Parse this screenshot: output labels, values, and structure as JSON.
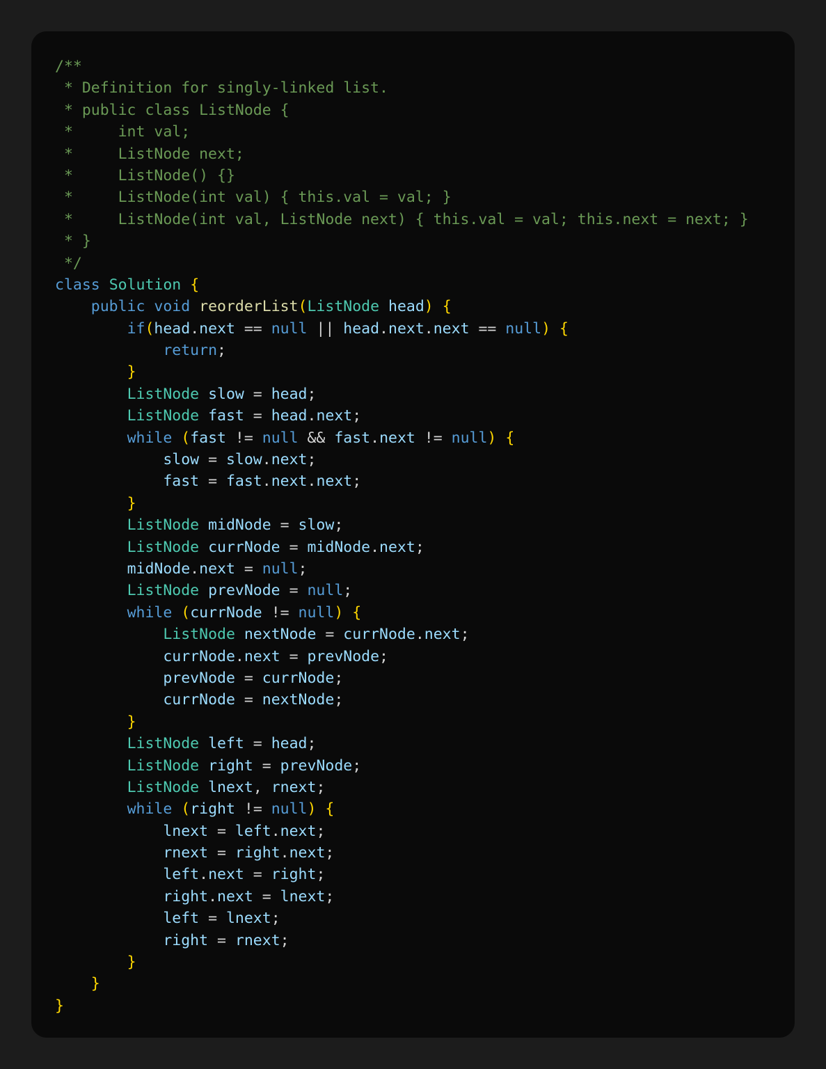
{
  "colors": {
    "page_background": "#1c1c1c",
    "editor_background": "#0a0a0a",
    "comment": "#6a9955",
    "keyword": "#569cd6",
    "type": "#4ec9b0",
    "class_name": "#4ec9b0",
    "method": "#dcdcaa",
    "identifier": "#9cdcfe",
    "punctuation": "#d4d4d4",
    "brace": "#ffd700"
  },
  "code": {
    "language": "java",
    "lines": [
      [
        [
          "comment",
          "/**"
        ]
      ],
      [
        [
          "comment",
          " * Definition for singly-linked list."
        ]
      ],
      [
        [
          "comment",
          " * public class ListNode {"
        ]
      ],
      [
        [
          "comment",
          " *     int val;"
        ]
      ],
      [
        [
          "comment",
          " *     ListNode next;"
        ]
      ],
      [
        [
          "comment",
          " *     ListNode() {}"
        ]
      ],
      [
        [
          "comment",
          " *     ListNode(int val) { this.val = val; }"
        ]
      ],
      [
        [
          "comment",
          " *     ListNode(int val, ListNode next) { this.val = val; this.next = next; }"
        ]
      ],
      [
        [
          "comment",
          " * }"
        ]
      ],
      [
        [
          "comment",
          " */"
        ]
      ],
      [
        [
          "keyword",
          "class"
        ],
        [
          "ws",
          " "
        ],
        [
          "class",
          "Solution"
        ],
        [
          "ws",
          " "
        ],
        [
          "brace",
          "{"
        ]
      ],
      [
        [
          "ws",
          "    "
        ],
        [
          "keyword",
          "public"
        ],
        [
          "ws",
          " "
        ],
        [
          "keyword",
          "void"
        ],
        [
          "ws",
          " "
        ],
        [
          "method",
          "reorderList"
        ],
        [
          "brace",
          "("
        ],
        [
          "type",
          "ListNode"
        ],
        [
          "ws",
          " "
        ],
        [
          "ident",
          "head"
        ],
        [
          "brace",
          ")"
        ],
        [
          "ws",
          " "
        ],
        [
          "brace",
          "{"
        ]
      ],
      [
        [
          "ws",
          "        "
        ],
        [
          "keyword",
          "if"
        ],
        [
          "brace",
          "("
        ],
        [
          "ident",
          "head"
        ],
        [
          "punct",
          "."
        ],
        [
          "ident",
          "next"
        ],
        [
          "punct",
          " == "
        ],
        [
          "keyword",
          "null"
        ],
        [
          "punct",
          " || "
        ],
        [
          "ident",
          "head"
        ],
        [
          "punct",
          "."
        ],
        [
          "ident",
          "next"
        ],
        [
          "punct",
          "."
        ],
        [
          "ident",
          "next"
        ],
        [
          "punct",
          " == "
        ],
        [
          "keyword",
          "null"
        ],
        [
          "brace",
          ")"
        ],
        [
          "ws",
          " "
        ],
        [
          "brace",
          "{"
        ]
      ],
      [
        [
          "ws",
          "            "
        ],
        [
          "keyword",
          "return"
        ],
        [
          "punct",
          ";"
        ]
      ],
      [
        [
          "ws",
          "        "
        ],
        [
          "brace",
          "}"
        ]
      ],
      [
        [
          "ws",
          "        "
        ],
        [
          "type",
          "ListNode"
        ],
        [
          "ws",
          " "
        ],
        [
          "ident",
          "slow"
        ],
        [
          "punct",
          " = "
        ],
        [
          "ident",
          "head"
        ],
        [
          "punct",
          ";"
        ]
      ],
      [
        [
          "ws",
          "        "
        ],
        [
          "type",
          "ListNode"
        ],
        [
          "ws",
          " "
        ],
        [
          "ident",
          "fast"
        ],
        [
          "punct",
          " = "
        ],
        [
          "ident",
          "head"
        ],
        [
          "punct",
          "."
        ],
        [
          "ident",
          "next"
        ],
        [
          "punct",
          ";"
        ]
      ],
      [
        [
          "ws",
          "        "
        ],
        [
          "keyword",
          "while"
        ],
        [
          "ws",
          " "
        ],
        [
          "brace",
          "("
        ],
        [
          "ident",
          "fast"
        ],
        [
          "punct",
          " != "
        ],
        [
          "keyword",
          "null"
        ],
        [
          "punct",
          " && "
        ],
        [
          "ident",
          "fast"
        ],
        [
          "punct",
          "."
        ],
        [
          "ident",
          "next"
        ],
        [
          "punct",
          " != "
        ],
        [
          "keyword",
          "null"
        ],
        [
          "brace",
          ")"
        ],
        [
          "ws",
          " "
        ],
        [
          "brace",
          "{"
        ]
      ],
      [
        [
          "ws",
          "            "
        ],
        [
          "ident",
          "slow"
        ],
        [
          "punct",
          " = "
        ],
        [
          "ident",
          "slow"
        ],
        [
          "punct",
          "."
        ],
        [
          "ident",
          "next"
        ],
        [
          "punct",
          ";"
        ]
      ],
      [
        [
          "ws",
          "            "
        ],
        [
          "ident",
          "fast"
        ],
        [
          "punct",
          " = "
        ],
        [
          "ident",
          "fast"
        ],
        [
          "punct",
          "."
        ],
        [
          "ident",
          "next"
        ],
        [
          "punct",
          "."
        ],
        [
          "ident",
          "next"
        ],
        [
          "punct",
          ";"
        ]
      ],
      [
        [
          "ws",
          "        "
        ],
        [
          "brace",
          "}"
        ]
      ],
      [
        [
          "ws",
          "        "
        ],
        [
          "type",
          "ListNode"
        ],
        [
          "ws",
          " "
        ],
        [
          "ident",
          "midNode"
        ],
        [
          "punct",
          " = "
        ],
        [
          "ident",
          "slow"
        ],
        [
          "punct",
          ";"
        ]
      ],
      [
        [
          "ws",
          "        "
        ],
        [
          "type",
          "ListNode"
        ],
        [
          "ws",
          " "
        ],
        [
          "ident",
          "currNode"
        ],
        [
          "punct",
          " = "
        ],
        [
          "ident",
          "midNode"
        ],
        [
          "punct",
          "."
        ],
        [
          "ident",
          "next"
        ],
        [
          "punct",
          ";"
        ]
      ],
      [
        [
          "ws",
          "        "
        ],
        [
          "ident",
          "midNode"
        ],
        [
          "punct",
          "."
        ],
        [
          "ident",
          "next"
        ],
        [
          "punct",
          " = "
        ],
        [
          "keyword",
          "null"
        ],
        [
          "punct",
          ";"
        ]
      ],
      [
        [
          "ws",
          "        "
        ],
        [
          "type",
          "ListNode"
        ],
        [
          "ws",
          " "
        ],
        [
          "ident",
          "prevNode"
        ],
        [
          "punct",
          " = "
        ],
        [
          "keyword",
          "null"
        ],
        [
          "punct",
          ";"
        ]
      ],
      [
        [
          "ws",
          "        "
        ],
        [
          "keyword",
          "while"
        ],
        [
          "ws",
          " "
        ],
        [
          "brace",
          "("
        ],
        [
          "ident",
          "currNode"
        ],
        [
          "punct",
          " != "
        ],
        [
          "keyword",
          "null"
        ],
        [
          "brace",
          ")"
        ],
        [
          "ws",
          " "
        ],
        [
          "brace",
          "{"
        ]
      ],
      [
        [
          "ws",
          "            "
        ],
        [
          "type",
          "ListNode"
        ],
        [
          "ws",
          " "
        ],
        [
          "ident",
          "nextNode"
        ],
        [
          "punct",
          " = "
        ],
        [
          "ident",
          "currNode"
        ],
        [
          "punct",
          "."
        ],
        [
          "ident",
          "next"
        ],
        [
          "punct",
          ";"
        ]
      ],
      [
        [
          "ws",
          "            "
        ],
        [
          "ident",
          "currNode"
        ],
        [
          "punct",
          "."
        ],
        [
          "ident",
          "next"
        ],
        [
          "punct",
          " = "
        ],
        [
          "ident",
          "prevNode"
        ],
        [
          "punct",
          ";"
        ]
      ],
      [
        [
          "ws",
          "            "
        ],
        [
          "ident",
          "prevNode"
        ],
        [
          "punct",
          " = "
        ],
        [
          "ident",
          "currNode"
        ],
        [
          "punct",
          ";"
        ]
      ],
      [
        [
          "ws",
          "            "
        ],
        [
          "ident",
          "currNode"
        ],
        [
          "punct",
          " = "
        ],
        [
          "ident",
          "nextNode"
        ],
        [
          "punct",
          ";"
        ]
      ],
      [
        [
          "ws",
          "        "
        ],
        [
          "brace",
          "}"
        ]
      ],
      [
        [
          "ws",
          "        "
        ],
        [
          "type",
          "ListNode"
        ],
        [
          "ws",
          " "
        ],
        [
          "ident",
          "left"
        ],
        [
          "punct",
          " = "
        ],
        [
          "ident",
          "head"
        ],
        [
          "punct",
          ";"
        ]
      ],
      [
        [
          "ws",
          "        "
        ],
        [
          "type",
          "ListNode"
        ],
        [
          "ws",
          " "
        ],
        [
          "ident",
          "right"
        ],
        [
          "punct",
          " = "
        ],
        [
          "ident",
          "prevNode"
        ],
        [
          "punct",
          ";"
        ]
      ],
      [
        [
          "ws",
          "        "
        ],
        [
          "type",
          "ListNode"
        ],
        [
          "ws",
          " "
        ],
        [
          "ident",
          "lnext"
        ],
        [
          "punct",
          ", "
        ],
        [
          "ident",
          "rnext"
        ],
        [
          "punct",
          ";"
        ]
      ],
      [
        [
          "ws",
          "        "
        ],
        [
          "keyword",
          "while"
        ],
        [
          "ws",
          " "
        ],
        [
          "brace",
          "("
        ],
        [
          "ident",
          "right"
        ],
        [
          "punct",
          " != "
        ],
        [
          "keyword",
          "null"
        ],
        [
          "brace",
          ")"
        ],
        [
          "ws",
          " "
        ],
        [
          "brace",
          "{"
        ]
      ],
      [
        [
          "ws",
          "            "
        ],
        [
          "ident",
          "lnext"
        ],
        [
          "punct",
          " = "
        ],
        [
          "ident",
          "left"
        ],
        [
          "punct",
          "."
        ],
        [
          "ident",
          "next"
        ],
        [
          "punct",
          ";"
        ]
      ],
      [
        [
          "ws",
          "            "
        ],
        [
          "ident",
          "rnext"
        ],
        [
          "punct",
          " = "
        ],
        [
          "ident",
          "right"
        ],
        [
          "punct",
          "."
        ],
        [
          "ident",
          "next"
        ],
        [
          "punct",
          ";"
        ]
      ],
      [
        [
          "ws",
          "            "
        ],
        [
          "ident",
          "left"
        ],
        [
          "punct",
          "."
        ],
        [
          "ident",
          "next"
        ],
        [
          "punct",
          " = "
        ],
        [
          "ident",
          "right"
        ],
        [
          "punct",
          ";"
        ]
      ],
      [
        [
          "ws",
          "            "
        ],
        [
          "ident",
          "right"
        ],
        [
          "punct",
          "."
        ],
        [
          "ident",
          "next"
        ],
        [
          "punct",
          " = "
        ],
        [
          "ident",
          "lnext"
        ],
        [
          "punct",
          ";"
        ]
      ],
      [
        [
          "ws",
          "            "
        ],
        [
          "ident",
          "left"
        ],
        [
          "punct",
          " = "
        ],
        [
          "ident",
          "lnext"
        ],
        [
          "punct",
          ";"
        ]
      ],
      [
        [
          "ws",
          "            "
        ],
        [
          "ident",
          "right"
        ],
        [
          "punct",
          " = "
        ],
        [
          "ident",
          "rnext"
        ],
        [
          "punct",
          ";"
        ]
      ],
      [
        [
          "ws",
          "        "
        ],
        [
          "brace",
          "}"
        ]
      ],
      [
        [
          "ws",
          "    "
        ],
        [
          "brace",
          "}"
        ]
      ],
      [
        [
          "brace",
          "}"
        ]
      ]
    ]
  }
}
